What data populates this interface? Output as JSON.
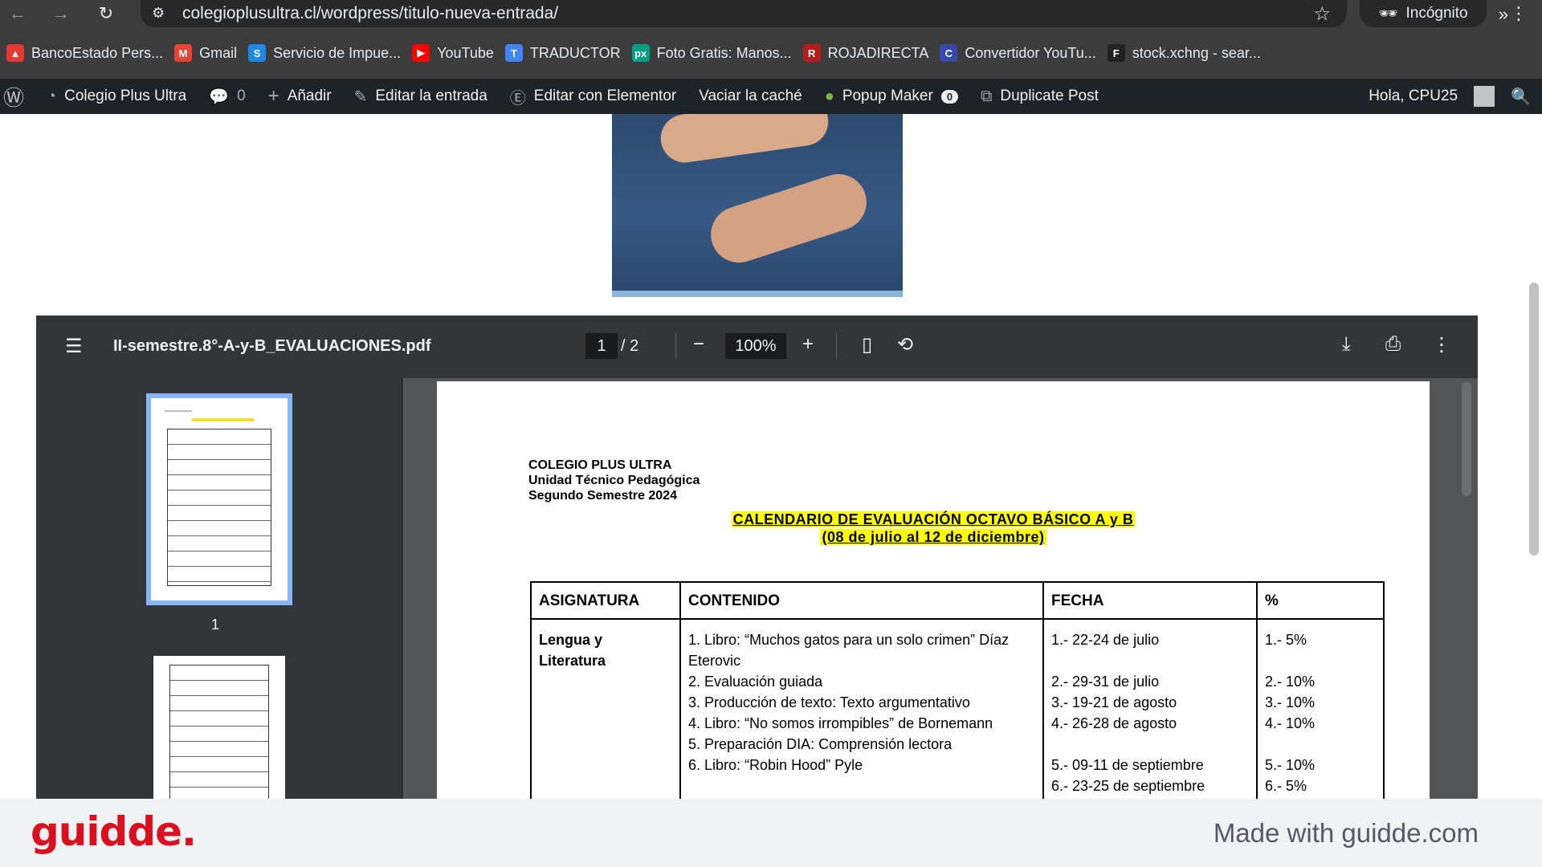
{
  "browser": {
    "url": "colegioplusultra.cl/wordpress/titulo-nueva-entrada/",
    "incognito_label": "Incógnito",
    "bookmarks": [
      {
        "label": "BancoEstado Pers...",
        "color": "#e53935",
        "glyph": "▲"
      },
      {
        "label": "Gmail",
        "color": "#ea4335",
        "glyph": "M"
      },
      {
        "label": "Servicio de Impue...",
        "color": "#1e88e5",
        "glyph": "S"
      },
      {
        "label": "YouTube",
        "color": "#ff0000",
        "glyph": "▶"
      },
      {
        "label": "TRADUCTOR",
        "color": "#4285f4",
        "glyph": "T"
      },
      {
        "label": "Foto Gratis: Manos...",
        "color": "#05a081",
        "glyph": "px"
      },
      {
        "label": "ROJADIRECTA",
        "color": "#b71c1c",
        "glyph": "R"
      },
      {
        "label": "Convertidor YouTu...",
        "color": "#3949ab",
        "glyph": "C"
      },
      {
        "label": "stock.xchng - sear...",
        "color": "#212121",
        "glyph": "F"
      }
    ]
  },
  "wp_admin_bar": {
    "site_name": "Colegio Plus Ultra",
    "comments_count": "0",
    "add_label": "Añadir",
    "edit_label": "Editar la entrada",
    "elementor_label": "Editar con Elementor",
    "cache_label": "Vaciar la caché",
    "popup_label": "Popup Maker",
    "popup_count": "0",
    "duplicate_label": "Duplicate Post",
    "greeting": "Hola, CPU25"
  },
  "pdf_viewer": {
    "filename": "II-semestre.8°-A-y-B_EVALUACIONES.pdf",
    "current_page": "1",
    "total_pages": "/ 2",
    "zoom": "100%",
    "thumbnail_label": "1"
  },
  "document": {
    "school_name": "COLEGIO PLUS ULTRA",
    "unit": "Unidad Técnico Pedagógica",
    "semester": "Segundo Semestre 2024",
    "title": "CALENDARIO DE EVALUACIÓN OCTAVO BÁSICO A y B",
    "subtitle": "(08 de julio al 12 de diciembre)",
    "table": {
      "headers": {
        "subject": "ASIGNATURA",
        "content": "CONTENIDO",
        "date": "FECHA",
        "percent": "%"
      },
      "row1": {
        "subject": "Lengua y Literatura",
        "contents": [
          "1. Libro: “Muchos gatos para un solo crimen” Díaz Eterovic",
          "2. Evaluación guiada",
          "3. Producción de texto: Texto argumentativo",
          "4. Libro: “No somos irrompibles” de Bornemann",
          "5. Preparación DIA: Comprensión lectora",
          "6. Libro: “Robin Hood” Pyle"
        ],
        "dates": [
          "1.- 22-24 de julio",
          "2.- 29-31 de julio",
          "3.- 19-21 de agosto",
          "4.- 26-28 de agosto",
          "5.- 09-11 de septiembre",
          "6.- 23-25 de septiembre"
        ],
        "percents": [
          "1.- 5%",
          "2.- 10%",
          "3.- 10%",
          "4.- 10%",
          "5.- 10%",
          "6.- 5%"
        ]
      }
    }
  },
  "footer": {
    "logo": "guidde.",
    "made_with": "Made with guidde.com"
  }
}
